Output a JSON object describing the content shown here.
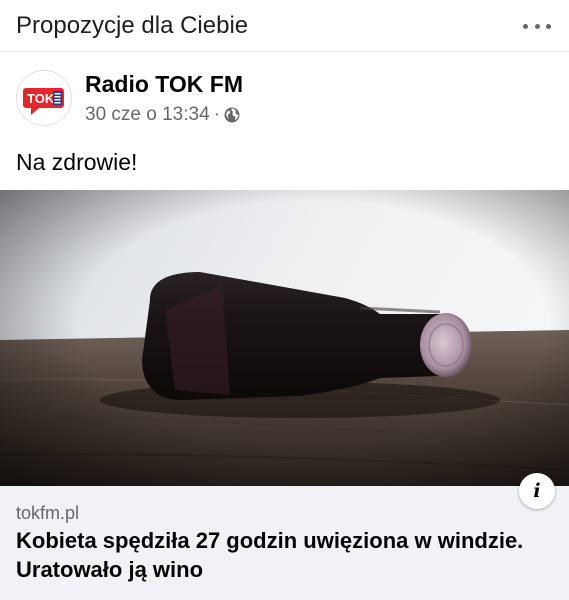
{
  "header": {
    "title": "Propozycje dla Ciebie"
  },
  "post": {
    "author": "Radio TOK FM",
    "avatar_text": "TOK",
    "date": "30 cze o 13:34",
    "separator": "·",
    "privacy_icon": "globe-icon",
    "text": "Na zdrowie!"
  },
  "link": {
    "domain": "tokfm.pl",
    "title": "Kobieta spędziła 27 godzin uwięziona w windzie. Uratowało ją wino"
  },
  "colors": {
    "brand_red": "#e3262e",
    "secondary_text": "#65676b",
    "preview_bg": "#f0f2f5"
  }
}
